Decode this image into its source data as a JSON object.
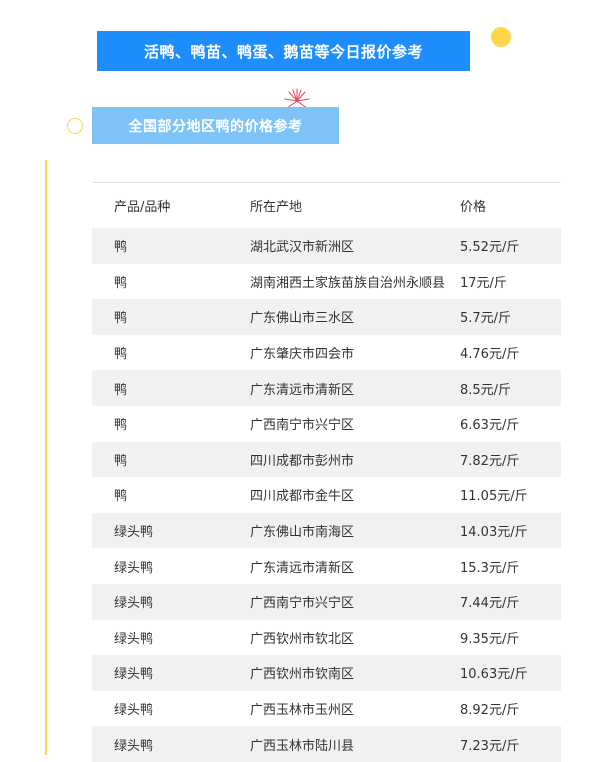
{
  "title": "活鸭、鸭苗、鸭蛋、鹅苗等今日报价参考",
  "subtitle": "全国部分地区鸭的价格参考",
  "colors": {
    "title_bg": "#1e8eff",
    "subtitle_bg": "#7ec3f7",
    "accent_yellow": "#ffd54a",
    "row_alt_bg": "#f1f1f1"
  },
  "table": {
    "headers": [
      "产品/品种",
      "所在产地",
      "价格"
    ],
    "rows": [
      [
        "鸭",
        "湖北武汉市新洲区",
        "5.52元/斤"
      ],
      [
        "鸭",
        "湖南湘西土家族苗族自治州永顺县",
        "17元/斤"
      ],
      [
        "鸭",
        "广东佛山市三水区",
        "5.7元/斤"
      ],
      [
        "鸭",
        "广东肇庆市四会市",
        "4.76元/斤"
      ],
      [
        "鸭",
        "广东清远市清新区",
        "8.5元/斤"
      ],
      [
        "鸭",
        "广西南宁市兴宁区",
        "6.63元/斤"
      ],
      [
        "鸭",
        "四川成都市彭州市",
        "7.82元/斤"
      ],
      [
        "鸭",
        "四川成都市金牛区",
        "11.05元/斤"
      ],
      [
        "绿头鸭",
        "广东佛山市南海区",
        "14.03元/斤"
      ],
      [
        "绿头鸭",
        "广东清远市清新区",
        "15.3元/斤"
      ],
      [
        "绿头鸭",
        "广西南宁市兴宁区",
        "7.44元/斤"
      ],
      [
        "绿头鸭",
        "广西钦州市钦北区",
        "9.35元/斤"
      ],
      [
        "绿头鸭",
        "广西钦州市钦南区",
        "10.63元/斤"
      ],
      [
        "绿头鸭",
        "广西玉林市玉州区",
        "8.92元/斤"
      ],
      [
        "绿头鸭",
        "广西玉林市陆川县",
        "7.23元/斤"
      ]
    ]
  }
}
